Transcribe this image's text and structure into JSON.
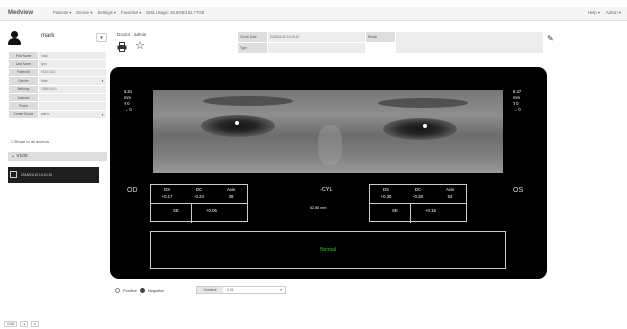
{
  "nav": {
    "brand": "Medview",
    "menu": [
      "Patients ▾",
      "Device ▾",
      "Settings ▾",
      "Favorites ▾",
      "Disk Usage: 26.6GB/102.77GB"
    ],
    "right": [
      "Help ▾",
      "Admin ▾"
    ]
  },
  "user": {
    "name": "mark",
    "dropdown": "▾"
  },
  "info": [
    {
      "k": "First Name",
      "v": "mark",
      "caret": false
    },
    {
      "k": "Last Name",
      "v": "lynn",
      "caret": false
    },
    {
      "k": "PatientID",
      "v": "92321423",
      "caret": false
    },
    {
      "k": "Gender",
      "v": "Male",
      "caret": true
    },
    {
      "k": "Birthday",
      "v": "1988/01/01",
      "caret": false
    },
    {
      "k": "Address",
      "v": "",
      "caret": false
    },
    {
      "k": "Phone",
      "v": "",
      "caret": false
    },
    {
      "k": "Create Doctor",
      "v": "admin",
      "caret": true
    }
  ],
  "share_label": "Share to all doctors.",
  "visit": {
    "header": "V100",
    "item": "2018/01/10 10:10:10"
  },
  "doctor": "Doctor : admin",
  "meta": {
    "date_label": "Check Date",
    "date_value": "2018/01/10 10:10:10",
    "type_label": "Type",
    "type_value": "",
    "result_label": "Result",
    "result_value": ""
  },
  "panel": {
    "left_pupil": "5.81",
    "left_unit": "mm",
    "left_a": "0",
    "left_b": "0",
    "right_pupil": "6.37",
    "right_unit": "mm",
    "right_a": "0",
    "right_b": "0",
    "od": "OD",
    "os": "OS",
    "headers": [
      "DS",
      "DC",
      "Axis"
    ],
    "od_vals": [
      "+0.17",
      "-0.24",
      "39"
    ],
    "os_vals": [
      "+0.30",
      "-0.28",
      "63"
    ],
    "se_label": "SE",
    "od_se": "+0.05",
    "os_se": "+0.16",
    "cyl": "-CYL",
    "distance": "52.85 mm",
    "result": "Normal"
  },
  "controls": {
    "positive": "Positive",
    "negative": "Negative",
    "gradient_label": "Gradient",
    "gradient_value": "0.01"
  },
  "footer": [
    "V100",
    "▴",
    "▾"
  ]
}
